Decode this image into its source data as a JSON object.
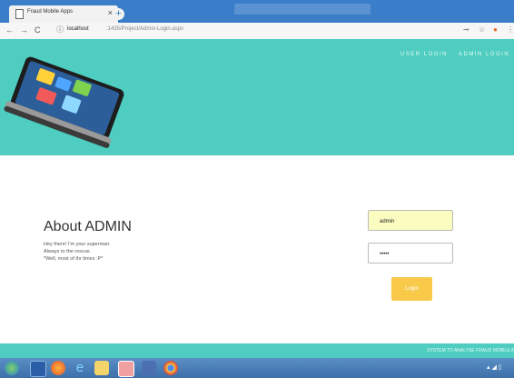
{
  "browser": {
    "tab_title": "Fraud Mobile Apps",
    "tab_close": "×",
    "new_tab": "+",
    "url_host": "localhost",
    "url_path": ":1435/Project/Admin-Login.aspx"
  },
  "header": {
    "nav": [
      "USER LOGIN",
      "ADMIN LOGIN"
    ]
  },
  "about": {
    "title": "About ADMIN",
    "lines": [
      "Hey there! I'm your superman.",
      "Always to the rescue.",
      "*Well, most of thr times :P*"
    ]
  },
  "login_form": {
    "username_value": "admin",
    "password_value": "•••••",
    "button_label": "Login"
  },
  "footer": {
    "text": "SYSTEM TO ANALYSE FRAUD MOBILE A"
  },
  "colors": {
    "accent": "#4ecdc0",
    "button": "#f9c94a",
    "username_bg": "#fbfcc0"
  },
  "taskbar": {
    "icons": [
      "windows-start-icon",
      "media-player-icon",
      "firefox-icon",
      "internet-explorer-icon",
      "file-explorer-icon",
      "paint-icon",
      "app-icon",
      "chrome-icon"
    ]
  }
}
